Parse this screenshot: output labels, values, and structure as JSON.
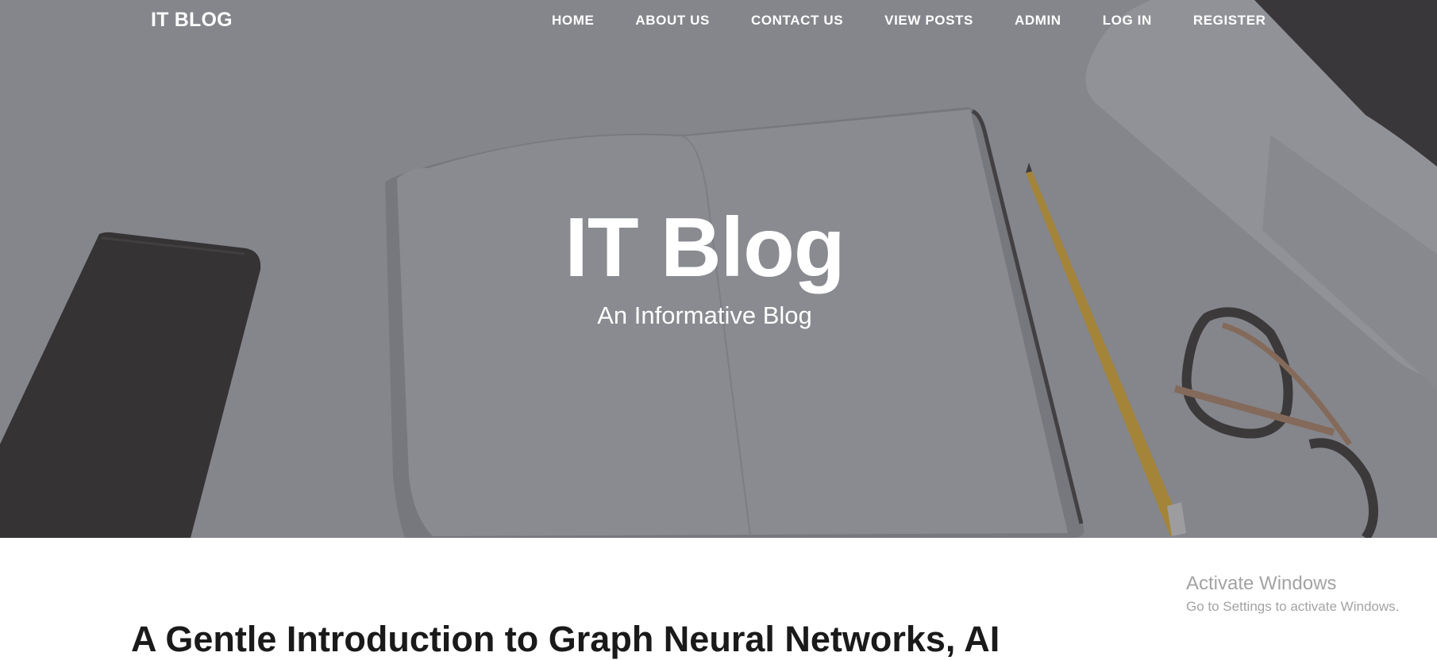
{
  "nav": {
    "brand": "IT BLOG",
    "links": [
      {
        "label": "HOME"
      },
      {
        "label": "ABOUT US"
      },
      {
        "label": "CONTACT US"
      },
      {
        "label": "VIEW POSTS"
      },
      {
        "label": "ADMIN"
      },
      {
        "label": "LOG IN"
      },
      {
        "label": "REGISTER"
      }
    ]
  },
  "hero": {
    "title": "IT Blog",
    "subtitle": "An Informative Blog"
  },
  "posts": [
    {
      "title": "A Gentle Introduction to Graph Neural Networks, AI"
    }
  ],
  "watermark": {
    "title": "Activate Windows",
    "subtitle": "Go to Settings to activate Windows."
  },
  "colors": {
    "hero_overlay": "#8a8c91",
    "nav_text": "#ffffff",
    "post_title": "#1a1a1a",
    "watermark_text": "#a3a3a3"
  }
}
